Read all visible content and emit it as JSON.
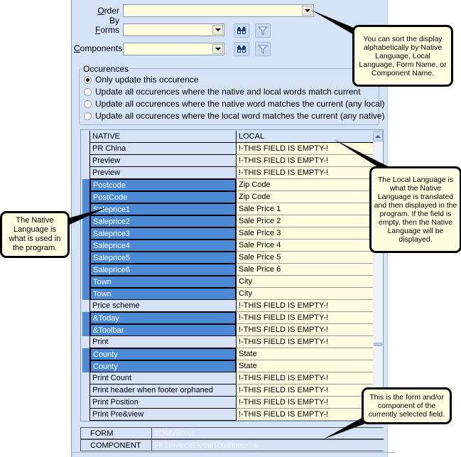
{
  "filters": {
    "order_by": {
      "label": "Order By",
      "accel": "O",
      "rest": "rder By",
      "value": ""
    },
    "forms": {
      "label": "Forms",
      "accel": "F",
      "rest": "orms",
      "value": ""
    },
    "components": {
      "label": "Components",
      "accel": "C",
      "rest": "omponents",
      "value": ""
    },
    "icons": {
      "search": "binoculars-icon",
      "filter": "funnel-icon"
    }
  },
  "occurrences": {
    "title": "Occurences",
    "options": [
      {
        "label": "Only update this occurence",
        "checked": true
      },
      {
        "label": "Update all occurences where the native and local words match current",
        "checked": false
      },
      {
        "label": "Update all occurences where the native word matches the current (any local)",
        "checked": false
      },
      {
        "label": "Update all occurences where the local word matches the current (any native)",
        "checked": false
      }
    ]
  },
  "grid": {
    "columns": [
      "NATIVE",
      "LOCAL"
    ],
    "rows": [
      {
        "native": "PR China",
        "local": "!-THIS FIELD IS EMPTY-!",
        "selected": false
      },
      {
        "native": "Preview",
        "local": "!-THIS FIELD IS EMPTY-!",
        "selected": false
      },
      {
        "native": "Preview",
        "local": "!-THIS FIELD IS EMPTY-!",
        "selected": false
      },
      {
        "native": "Postcode",
        "local": "Zip Code",
        "selected": true
      },
      {
        "native": "PostCode",
        "local": "Zip Code",
        "selected": true
      },
      {
        "native": "Saleprice1",
        "local": "Sale Price 1",
        "selected": true
      },
      {
        "native": "Saleprice2",
        "local": "Sale Price 2",
        "selected": true
      },
      {
        "native": "Saleprice3",
        "local": "Sale Price 3",
        "selected": true
      },
      {
        "native": "Saleprice4",
        "local": "Sale Price 4",
        "selected": true
      },
      {
        "native": "Saleprice5",
        "local": "Sale Price 5",
        "selected": true
      },
      {
        "native": "Saleprice6",
        "local": "Sale Price 6",
        "selected": true
      },
      {
        "native": "Town",
        "local": "City",
        "selected": true
      },
      {
        "native": "Town",
        "local": "City",
        "selected": true
      },
      {
        "native": "Price scheme",
        "local": "!-THIS FIELD IS EMPTY-!",
        "selected": false
      },
      {
        "native": "&Today",
        "local": "!-THIS FIELD IS EMPTY-!",
        "selected": true
      },
      {
        "native": "&Toolbar",
        "local": "!-THIS FIELD IS EMPTY-!",
        "selected": true
      },
      {
        "native": "Print",
        "local": "!-THIS FIELD IS EMPTY-!",
        "selected": false
      },
      {
        "native": "County",
        "local": "State",
        "selected": true
      },
      {
        "native": "County",
        "local": "State",
        "selected": true
      },
      {
        "native": "Print Count",
        "local": "!-THIS FIELD IS EMPTY-!",
        "selected": false
      },
      {
        "native": "Print header when footer orphaned",
        "local": "!-THIS FIELD IS EMPTY-!",
        "selected": false
      },
      {
        "native": "Print Position",
        "local": "!-THIS FIELD IS EMPTY-!",
        "selected": false
      },
      {
        "native": "Print Pre&view",
        "local": "!-THIS FIELD IS EMPTY-!",
        "selected": false
      }
    ],
    "scroll_position": 0.73
  },
  "info": {
    "form_label": "FORM",
    "form_value": "TDMViewer",
    "component_label": "COMPONENT",
    "component_value": "FFTInvoiceDetailTotallineprice"
  },
  "callouts": {
    "sort": "You can sort the display alphabetically by Native Language, Local Language, Form Name, or Component Name.",
    "local": "The Local Language is what the Native Language is translated and then displayed in the program. If the field is empty, then the Native Language will be displayed.",
    "native": "The Native Language is what is used in the program.",
    "form": "This is the form and/or component of the currently selected field."
  },
  "colors": {
    "panel": "#d6e3f7",
    "selection": "#4d8ad6",
    "field": "#fffde0",
    "callout": "#ffffe1"
  }
}
